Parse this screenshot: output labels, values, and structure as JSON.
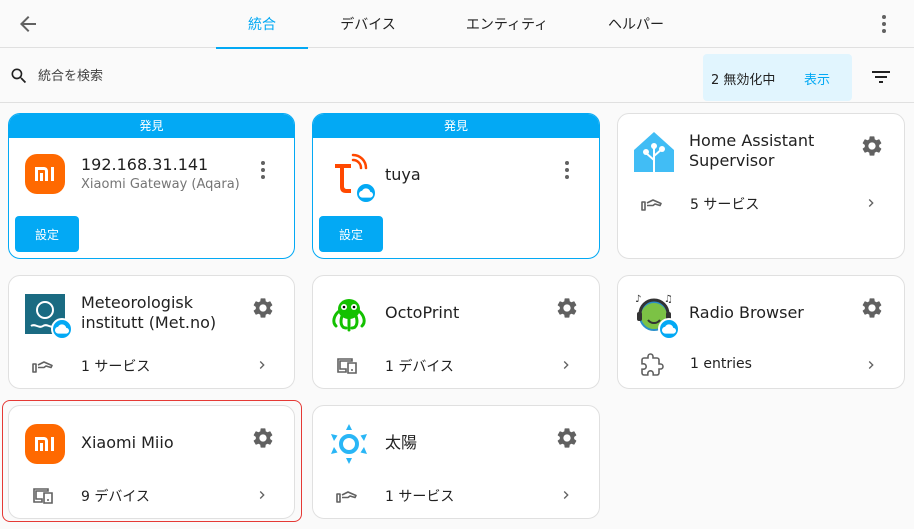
{
  "tabs": [
    "統合",
    "デバイス",
    "エンティティ",
    "ヘルパー"
  ],
  "search": {
    "placeholder": "統合を検索"
  },
  "disabled": {
    "text": "2 無効化中",
    "show_label": "表示"
  },
  "discovered_label": "発見",
  "configure_label": "設定",
  "cards": {
    "xiaomi_gateway": {
      "title": "192.168.31.141",
      "subtitle": "Xiaomi Gateway (Aqara)"
    },
    "tuya": {
      "title": "tuya"
    },
    "supervisor": {
      "title": "Home Assistant Supervisor",
      "footer": "5 サービス"
    },
    "met_no": {
      "title": "Meteorologisk institutt (Met.no)",
      "footer": "1 サービス"
    },
    "octoprint": {
      "title": "OctoPrint",
      "footer": "1 デバイス"
    },
    "radio_browser": {
      "title": "Radio Browser",
      "footer": "1 entries"
    },
    "xiaomi_miio": {
      "title": "Xiaomi Miio",
      "footer": "9 デバイス"
    },
    "sun": {
      "title": "太陽",
      "footer": "1 サービス"
    }
  },
  "colors": {
    "accent": "#03a9f4",
    "xiaomi_orange": "#ff6900",
    "highlight_red": "#e53935"
  },
  "icons": {
    "back": "arrow-left-icon",
    "menu": "dots-vertical-icon",
    "search": "magnify-icon",
    "filter": "filter-variant-icon",
    "service": "hand-service-icon",
    "device": "devices-icon",
    "entries": "puzzle-icon",
    "cloud": "cloud-icon",
    "settings": "cog-icon"
  }
}
